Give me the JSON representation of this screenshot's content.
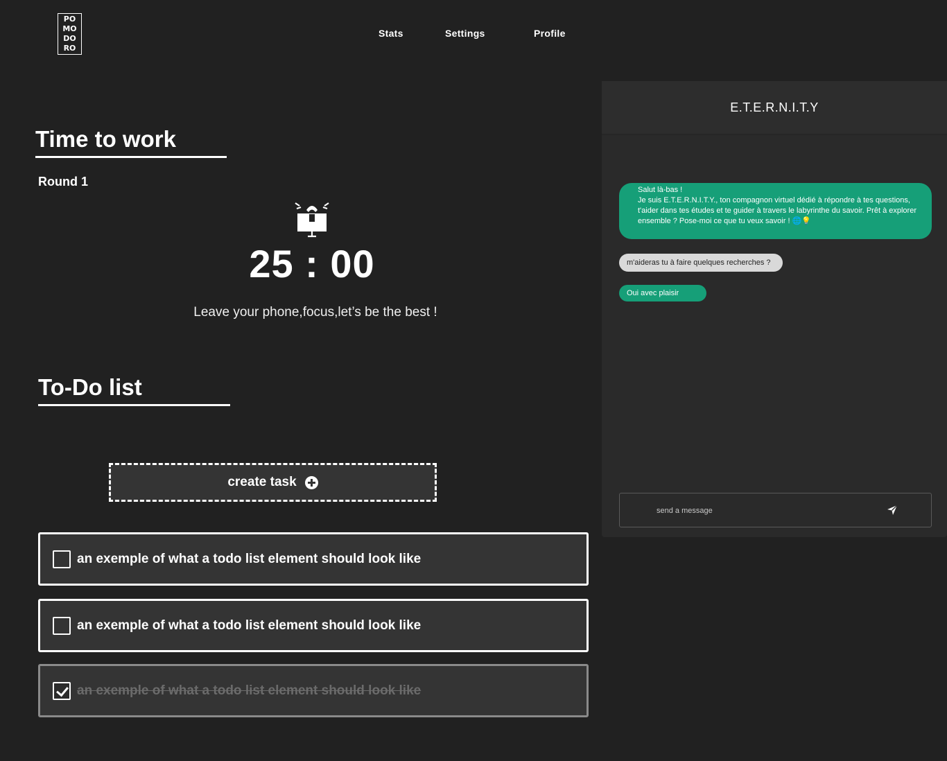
{
  "logo": {
    "lines": [
      "PO",
      "MO",
      "DO",
      "RO"
    ]
  },
  "nav": {
    "stats": "Stats",
    "settings": "Settings",
    "profile": "Profile"
  },
  "work": {
    "title": "Time to work",
    "round": "Round 1",
    "timer": "25 : 00",
    "motto": "Leave your phone,focus,let’s be the best !",
    "icon": "alarm-clock-icon"
  },
  "todo": {
    "title": "To-Do list",
    "create_label": "create task",
    "items": [
      {
        "text": "an exemple of what a todo list element should look like",
        "checked": false
      },
      {
        "text": "an exemple of what a todo list element should look like",
        "checked": false
      },
      {
        "text": "an exemple of what a todo list element should look like",
        "checked": true
      }
    ]
  },
  "chat": {
    "title": "E.T.E.R.N.I.T.Y",
    "messages": [
      {
        "from": "bot",
        "lines": [
          "Salut là-bas !",
          "Je suis E.T.E.R.N.I.T.Y., ton compagnon virtuel dédié à répondre à tes questions, t'aider dans tes études et te guider à travers le labyrinthe du savoir. Prêt à explorer ensemble ? Pose-moi ce que tu veux savoir ! 🌐💡"
        ]
      },
      {
        "from": "user",
        "text": "m'aideras tu à faire quelques recherches ?"
      },
      {
        "from": "bot",
        "text": "Oui avec plaisir"
      }
    ],
    "input_placeholder": "send a message"
  },
  "colors": {
    "background": "#212121",
    "panel": "#343434",
    "accent_green": "#169f78",
    "user_bubble": "#d9d9d9"
  }
}
